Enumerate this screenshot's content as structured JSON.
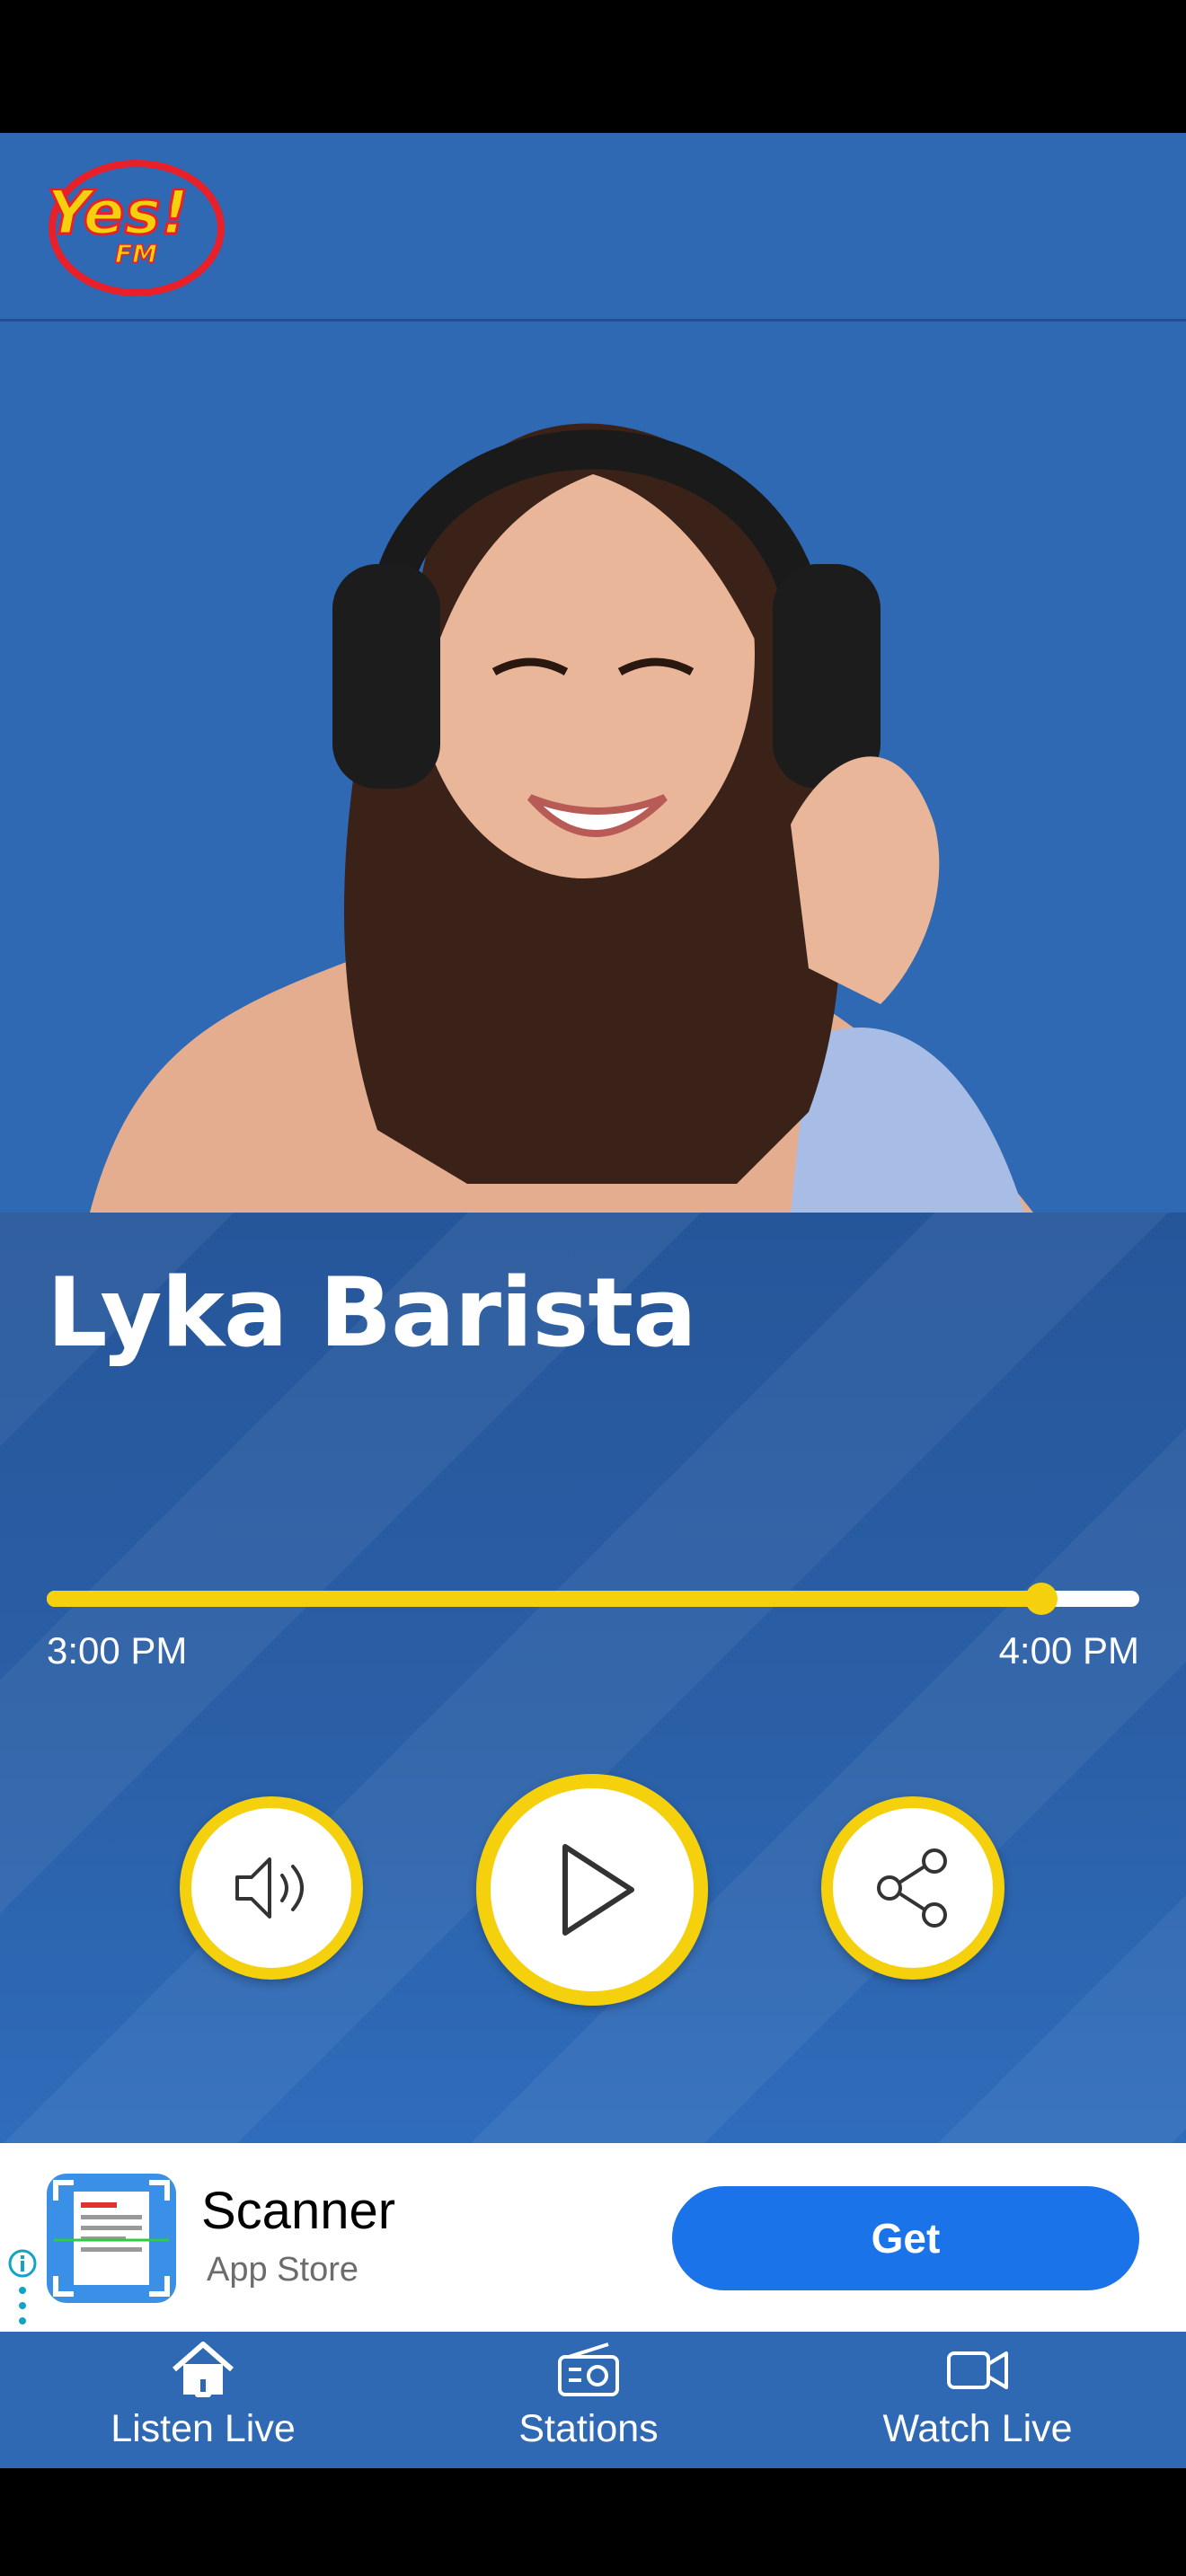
{
  "app": {
    "logo_text": "Yes!",
    "logo_subtext": "FM"
  },
  "colors": {
    "primary_blue": "#2f68b3",
    "accent_yellow": "#f5d10d",
    "ad_button_blue": "#1a73e8"
  },
  "now_playing": {
    "host_name": "Lyka Barista",
    "start_time": "3:00 PM",
    "end_time": "4:00 PM",
    "progress_percent": 91
  },
  "controls": {
    "volume_icon": "speaker-icon",
    "play_icon": "play-icon",
    "share_icon": "share-icon"
  },
  "ad": {
    "title": "Scanner",
    "subtitle": "App Store",
    "cta": "Get"
  },
  "nav": {
    "items": [
      {
        "label": "Listen Live",
        "icon": "home-icon"
      },
      {
        "label": "Stations",
        "icon": "radio-icon"
      },
      {
        "label": "Watch Live",
        "icon": "video-camera-icon"
      }
    ]
  }
}
